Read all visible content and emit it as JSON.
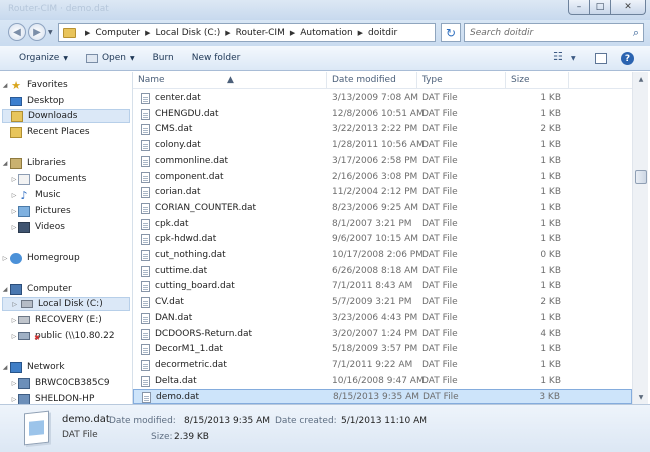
{
  "window": {
    "title_ghost": "Router-CIM · demo.dat",
    "minimize_glyph": "–",
    "maximize_glyph": "□",
    "close_glyph": "✕"
  },
  "address": {
    "crumbs": [
      "Computer",
      "Local Disk (C:)",
      "Router-CIM",
      "Automation",
      "doitdir"
    ],
    "search_placeholder": "Search doitdir"
  },
  "toolbar": {
    "organize_label": "Organize",
    "open_label": "Open",
    "burn_label": "Burn",
    "new_folder_label": "New folder"
  },
  "sidebar": {
    "favorites_label": "Favorites",
    "favorites": [
      "Desktop",
      "Downloads",
      "Recent Places"
    ],
    "libraries_label": "Libraries",
    "libraries": [
      "Documents",
      "Music",
      "Pictures",
      "Videos"
    ],
    "homegroup_label": "Homegroup",
    "computer_label": "Computer",
    "drives": [
      "Local Disk (C:)",
      "RECOVERY (E:)",
      "public (\\\\10.80.22"
    ],
    "network_label": "Network",
    "network": [
      "BRWC0CB385C9",
      "SHELDON-HP"
    ]
  },
  "columns": {
    "name": "Name",
    "date_modified": "Date modified",
    "type": "Type",
    "size": "Size"
  },
  "files": [
    {
      "name": "center.dat",
      "date": "3/13/2009 7:08 AM",
      "type": "DAT File",
      "size": "1 KB"
    },
    {
      "name": "CHENGDU.dat",
      "date": "12/8/2006 10:51 AM",
      "type": "DAT File",
      "size": "1 KB"
    },
    {
      "name": "CMS.dat",
      "date": "3/22/2013 2:22 PM",
      "type": "DAT File",
      "size": "2 KB"
    },
    {
      "name": "colony.dat",
      "date": "1/28/2011 10:56 AM",
      "type": "DAT File",
      "size": "1 KB"
    },
    {
      "name": "commonline.dat",
      "date": "3/17/2006 2:58 PM",
      "type": "DAT File",
      "size": "1 KB"
    },
    {
      "name": "component.dat",
      "date": "2/16/2006 3:08 PM",
      "type": "DAT File",
      "size": "1 KB"
    },
    {
      "name": "corian.dat",
      "date": "11/2/2004 2:12 PM",
      "type": "DAT File",
      "size": "1 KB"
    },
    {
      "name": "CORIAN_COUNTER.dat",
      "date": "8/23/2006 9:25 AM",
      "type": "DAT File",
      "size": "1 KB"
    },
    {
      "name": "cpk.dat",
      "date": "8/1/2007 3:21 PM",
      "type": "DAT File",
      "size": "1 KB"
    },
    {
      "name": "cpk-hdwd.dat",
      "date": "9/6/2007 10:15 AM",
      "type": "DAT File",
      "size": "1 KB"
    },
    {
      "name": "cut_nothing.dat",
      "date": "10/17/2008 2:06 PM",
      "type": "DAT File",
      "size": "0 KB"
    },
    {
      "name": "cuttime.dat",
      "date": "6/26/2008 8:18 AM",
      "type": "DAT File",
      "size": "1 KB"
    },
    {
      "name": "cutting_board.dat",
      "date": "7/1/2011 8:43 AM",
      "type": "DAT File",
      "size": "1 KB"
    },
    {
      "name": "CV.dat",
      "date": "5/7/2009 3:21 PM",
      "type": "DAT File",
      "size": "2 KB"
    },
    {
      "name": "DAN.dat",
      "date": "3/23/2006 4:43 PM",
      "type": "DAT File",
      "size": "1 KB"
    },
    {
      "name": "DCDOORS-Return.dat",
      "date": "3/20/2007 1:24 PM",
      "type": "DAT File",
      "size": "4 KB"
    },
    {
      "name": "DecorM1_1.dat",
      "date": "5/18/2009 3:57 PM",
      "type": "DAT File",
      "size": "1 KB"
    },
    {
      "name": "decormetric.dat",
      "date": "7/1/2011 9:22 AM",
      "type": "DAT File",
      "size": "1 KB"
    },
    {
      "name": "Delta.dat",
      "date": "10/16/2008 9:47 AM",
      "type": "DAT File",
      "size": "1 KB"
    },
    {
      "name": "demo.dat",
      "date": "8/15/2013 9:35 AM",
      "type": "DAT File",
      "size": "3 KB"
    }
  ],
  "selected_index": 19,
  "details": {
    "name": "demo.dat",
    "type": "DAT File",
    "date_modified_label": "Date modified:",
    "date_modified": "8/15/2013 9:35 AM",
    "date_created_label": "Date created:",
    "date_created": "5/1/2013 11:10 AM",
    "size_label": "Size:",
    "size": "2.39 KB"
  }
}
